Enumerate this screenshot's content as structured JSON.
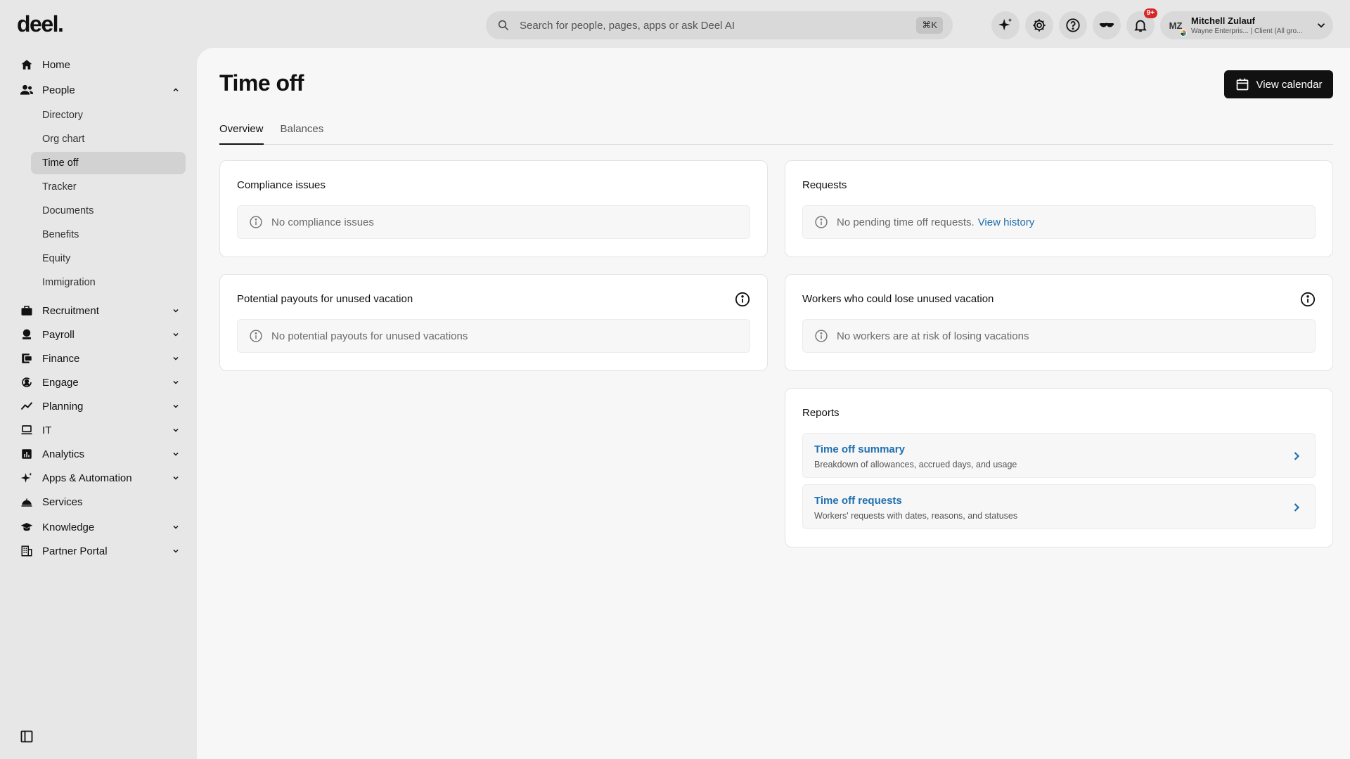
{
  "app": {
    "logo": "deel."
  },
  "search": {
    "placeholder": "Search for people, pages, apps or ask Deel AI",
    "shortcut": "⌘K"
  },
  "notifications": {
    "badge": "9+"
  },
  "user": {
    "initials": "MZ",
    "name": "Mitchell Zulauf",
    "subtitle": "Wayne Enterpris... | Client (All gro..."
  },
  "sidebar": {
    "items": [
      {
        "label": "Home",
        "icon": "home-icon"
      },
      {
        "label": "People",
        "icon": "people-icon",
        "expanded": true,
        "children": [
          "Directory",
          "Org chart",
          "Time off",
          "Tracker",
          "Documents",
          "Benefits",
          "Equity",
          "Immigration"
        ]
      },
      {
        "label": "Recruitment",
        "icon": "briefcase-icon"
      },
      {
        "label": "Payroll",
        "icon": "payroll-icon"
      },
      {
        "label": "Finance",
        "icon": "finance-icon"
      },
      {
        "label": "Engage",
        "icon": "engage-icon"
      },
      {
        "label": "Planning",
        "icon": "planning-icon"
      },
      {
        "label": "IT",
        "icon": "laptop-icon"
      },
      {
        "label": "Analytics",
        "icon": "analytics-icon"
      },
      {
        "label": "Apps & Automation",
        "icon": "sparkle-icon"
      },
      {
        "label": "Services",
        "icon": "services-icon"
      },
      {
        "label": "Knowledge",
        "icon": "graduation-cap-icon"
      },
      {
        "label": "Partner Portal",
        "icon": "building-icon"
      }
    ],
    "active_sub_item": "Time off"
  },
  "page": {
    "title": "Time off",
    "view_calendar_label": "View calendar",
    "tabs": [
      "Overview",
      "Balances"
    ],
    "active_tab": "Overview"
  },
  "cards": {
    "compliance": {
      "title": "Compliance issues",
      "empty": "No compliance issues"
    },
    "requests": {
      "title": "Requests",
      "empty": "No pending time off requests.",
      "link": "View history"
    },
    "payouts": {
      "title": "Potential payouts for unused vacation",
      "empty": "No potential payouts for unused vacations"
    },
    "workers": {
      "title": "Workers who could lose unused vacation",
      "empty": "No workers are at risk of losing vacations"
    },
    "reports": {
      "title": "Reports",
      "items": [
        {
          "title": "Time off summary",
          "desc": "Breakdown of allowances, accrued days, and usage"
        },
        {
          "title": "Time off requests",
          "desc": "Workers' requests with dates, reasons, and statuses"
        }
      ]
    }
  },
  "colors": {
    "accent_link": "#1f6fae",
    "primary_button": "#111111",
    "badge": "#d62828",
    "sidebar_bg": "#e7e7e7",
    "main_bg": "#f7f7f7"
  }
}
